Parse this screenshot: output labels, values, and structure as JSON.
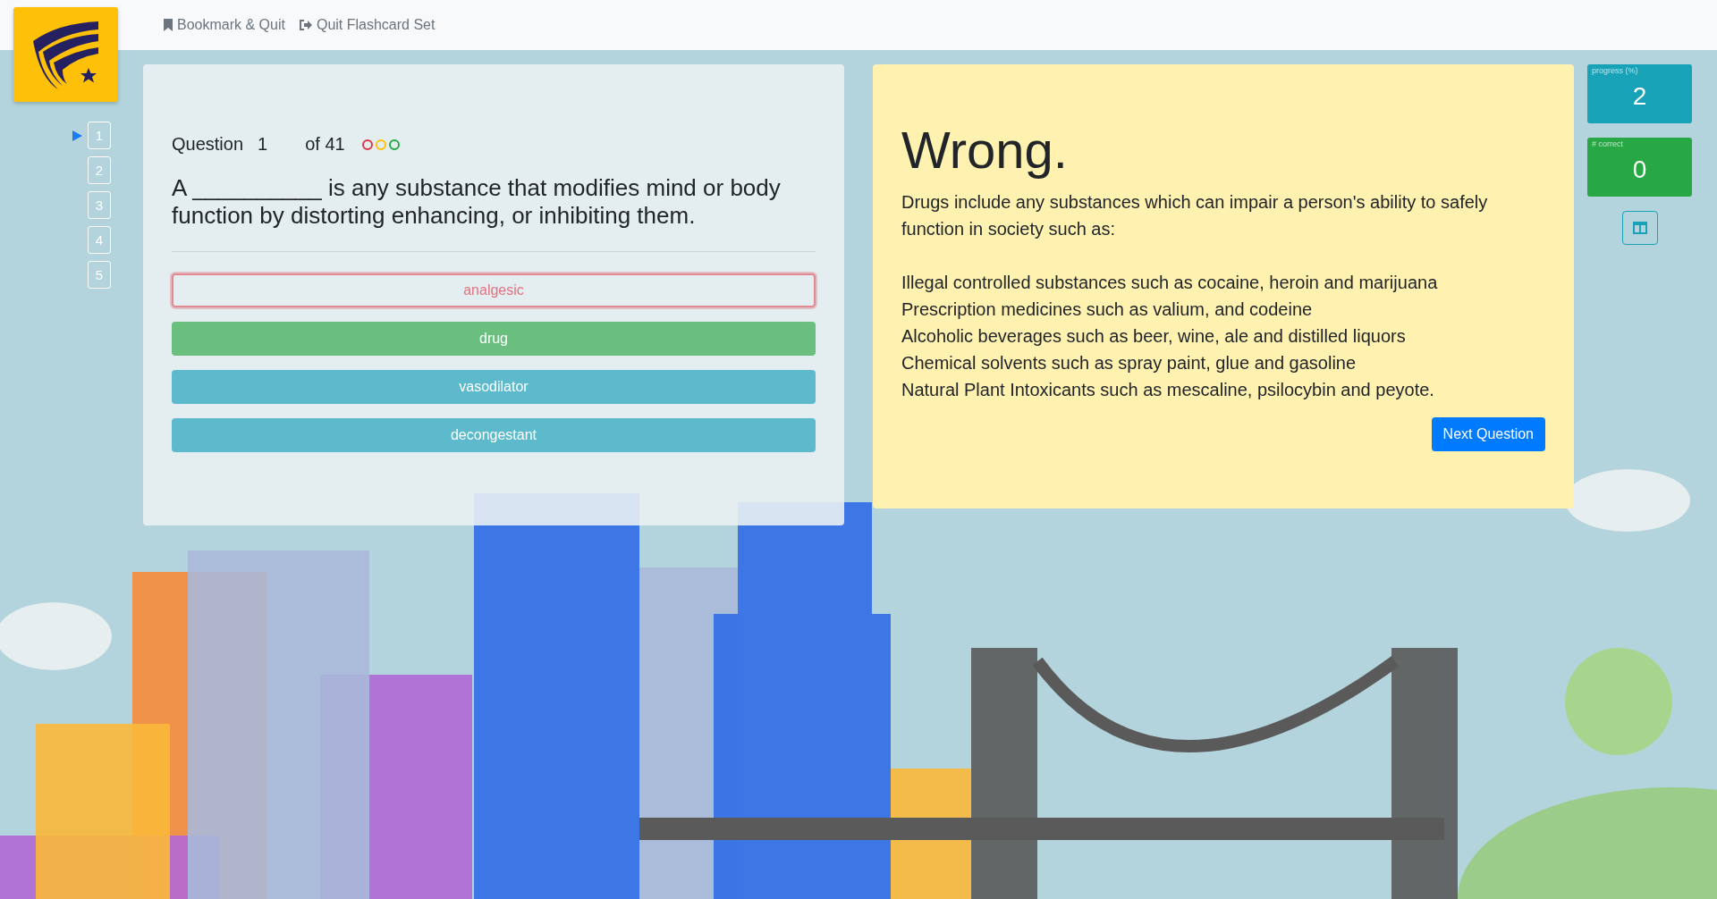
{
  "header": {
    "links": [
      {
        "label": "Bookmark & Quit",
        "kind": "bookmark"
      },
      {
        "label": "Quit Flashcard Set",
        "kind": "exit"
      }
    ]
  },
  "question_nav": [
    {
      "label": "1",
      "selected": true
    },
    {
      "label": "2",
      "selected": false
    },
    {
      "label": "3",
      "selected": false
    },
    {
      "label": "4",
      "selected": false
    },
    {
      "label": "5",
      "selected": false
    }
  ],
  "question": {
    "label": "Question",
    "number": "1",
    "total": "of 41",
    "dots": [
      {
        "color": "#dc3545"
      },
      {
        "color": "#ffc107"
      },
      {
        "color": "#28a745"
      }
    ],
    "text": "A __________ is any substance that modifies mind or body function by distorting enhancing, or inhibiting them.",
    "answers": [
      {
        "label": "analgesic",
        "kind": "wrong"
      },
      {
        "label": "drug",
        "kind": "correct"
      },
      {
        "label": "vasodilator",
        "kind": "neutral"
      },
      {
        "label": "decongestant",
        "kind": "neutral"
      }
    ]
  },
  "feedback": {
    "title": "Wrong.",
    "intro": "Drugs include any substances which can impair a person's ability to safely function in society such as:",
    "lines": [
      "Illegal controlled substances such as cocaine, heroin and marijuana",
      "Prescription medicines such as valium, and codeine",
      "Alcoholic beverages such as beer, wine, ale and distilled liquors",
      "Chemical solvents such as spray paint, glue and gasoline",
      "Natural Plant Intoxicants such as mescaline, psilocybin and peyote."
    ],
    "button": "Next Question"
  },
  "stats": [
    {
      "label": "progress (%)",
      "value": "2",
      "color": "#17a2b8"
    },
    {
      "label": "# correct",
      "value": "0",
      "color": "#28a745"
    }
  ]
}
